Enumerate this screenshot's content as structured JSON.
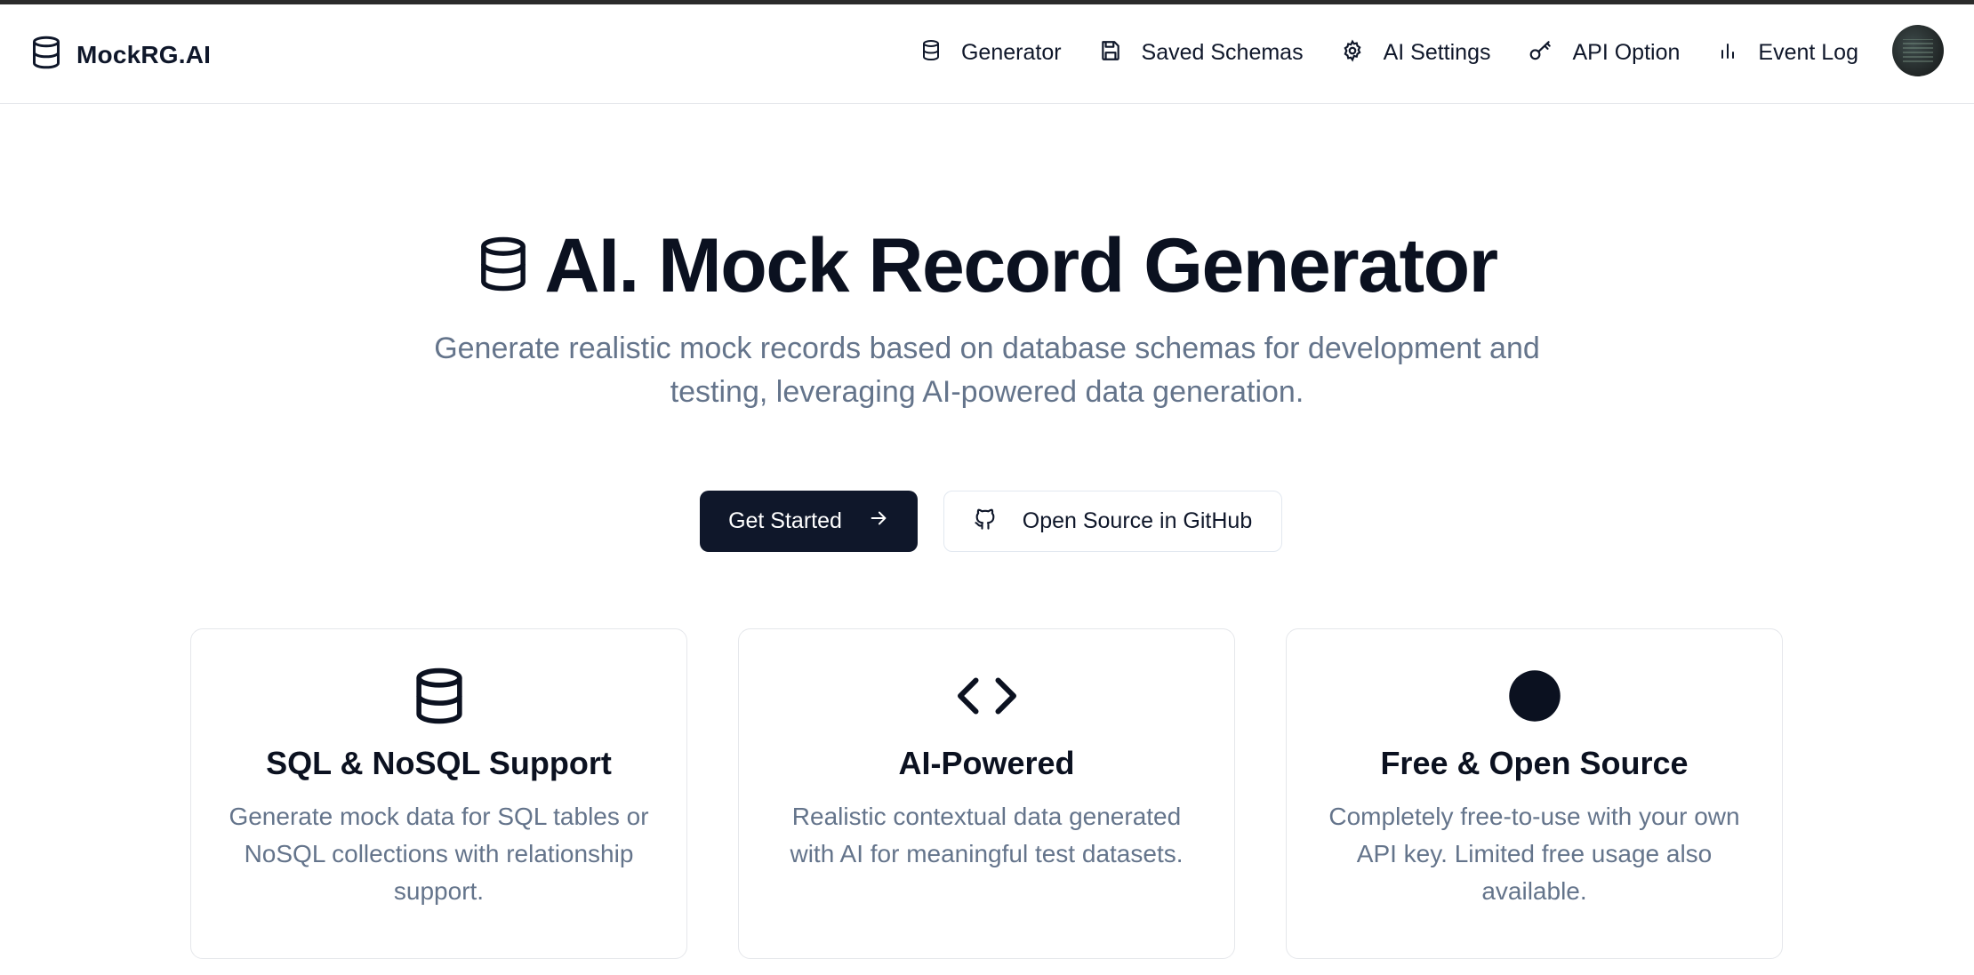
{
  "brand": {
    "name": "MockRG.AI",
    "icon": "database-icon"
  },
  "nav": {
    "items": [
      {
        "label": "Generator",
        "icon": "database-icon"
      },
      {
        "label": "Saved Schemas",
        "icon": "save-icon"
      },
      {
        "label": "AI Settings",
        "icon": "gear-icon"
      },
      {
        "label": "API Option",
        "icon": "key-icon"
      },
      {
        "label": "Event Log",
        "icon": "bar-chart-icon"
      }
    ]
  },
  "hero": {
    "title": "AI. Mock Record Generator",
    "subtitle": "Generate realistic mock records based on database schemas for development and testing, leveraging AI-powered data generation."
  },
  "cta": {
    "primary_label": "Get Started",
    "secondary_label": "Open Source in GitHub"
  },
  "features": [
    {
      "title": "SQL & NoSQL Support",
      "description": "Generate mock data for SQL tables or NoSQL collections with relationship support.",
      "icon": "database-icon"
    },
    {
      "title": "AI-Powered",
      "description": "Realistic contextual data generated with AI for meaningful test datasets.",
      "icon": "code-icon"
    },
    {
      "title": "Free & Open Source",
      "description": "Completely free-to-use with your own API key. Limited free usage also available.",
      "icon": "filled-circle-icon"
    }
  ],
  "colors": {
    "primary": "#0f172a",
    "muted": "#64748b",
    "border": "#e5e7eb"
  }
}
